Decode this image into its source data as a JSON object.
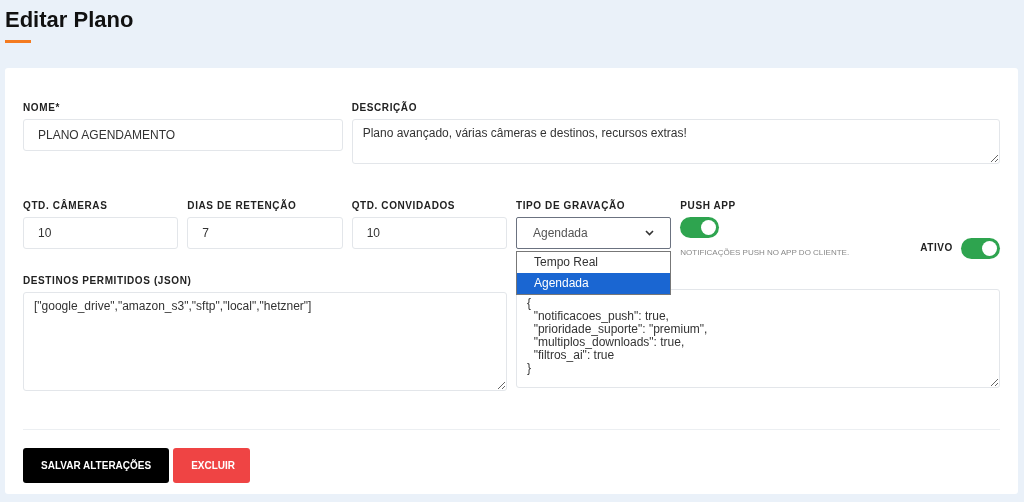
{
  "page": {
    "title": "Editar Plano"
  },
  "fields": {
    "nome": {
      "label": "NOME*",
      "value": "PLANO AGENDAMENTO"
    },
    "descricao": {
      "label": "DESCRIÇÃO",
      "value": "Plano avançado, várias câmeras e destinos, recursos extras!"
    },
    "cameras": {
      "label": "QTD. CÂMERAS",
      "value": "10"
    },
    "retencao": {
      "label": "DIAS DE RETENÇÃO",
      "value": "7"
    },
    "convidados": {
      "label": "QTD. CONVIDADOS",
      "value": "10"
    },
    "gravacao": {
      "label": "TIPO DE GRAVAÇÃO",
      "value": "Agendada",
      "expanded": true,
      "options": [
        {
          "label": "Tempo Real",
          "selected": false
        },
        {
          "label": "Agendada",
          "selected": true
        }
      ]
    },
    "push": {
      "label": "PUSH APP",
      "on": true,
      "hint": "NOTIFICAÇÕES PUSH NO APP DO CLIENTE."
    },
    "ativo": {
      "label": "ATIVO",
      "on": true
    },
    "destinos": {
      "label": "DESTINOS PERMITIDOS (JSON)",
      "value": "[\"google_drive\",\"amazon_s3\",\"sftp\",\"local\",\"hetzner\"]"
    },
    "recursos": {
      "value": "{\n  \"notificacoes_push\": true,\n  \"prioridade_suporte\": \"premium\",\n  \"multiplos_downloads\": true,\n  \"filtros_ai\": true\n}"
    }
  },
  "buttons": {
    "save": "SALVAR ALTERAÇÕES",
    "delete": "EXCLUIR"
  }
}
